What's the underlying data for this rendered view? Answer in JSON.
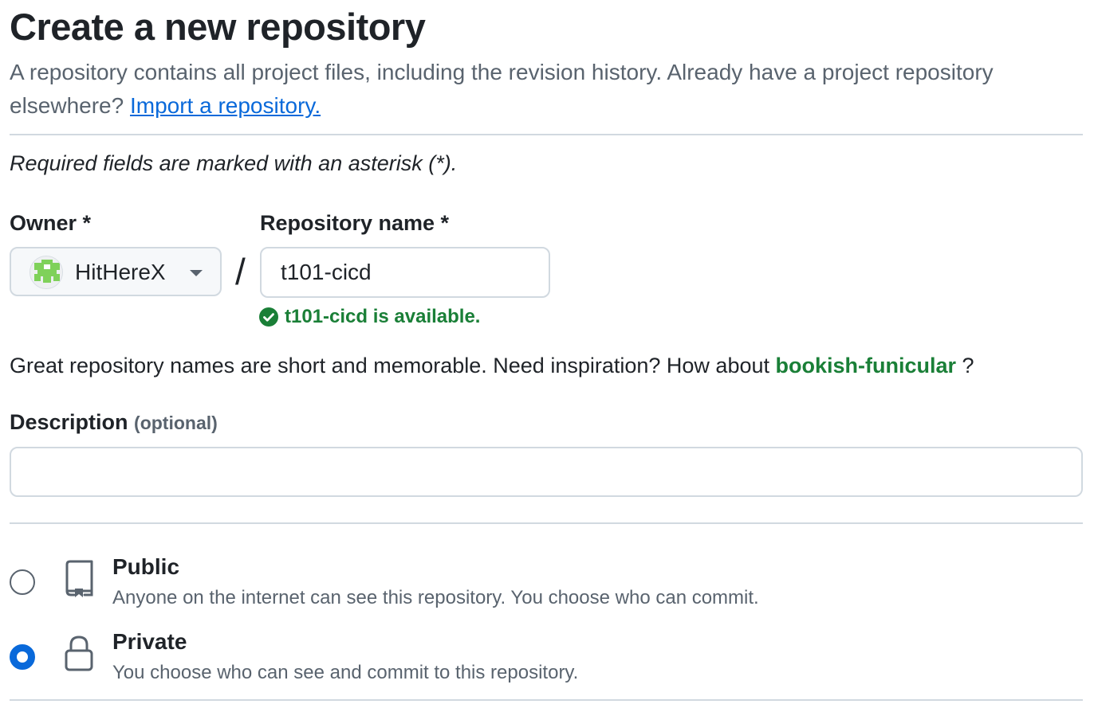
{
  "header": {
    "title": "Create a new repository",
    "subtitle": "A repository contains all project files, including the revision history. Already have a project repository elsewhere?",
    "import_link": "Import a repository."
  },
  "form": {
    "required_note": "Required fields are marked with an asterisk (*).",
    "owner": {
      "label": "Owner *",
      "value": "HitHereX"
    },
    "separator": "/",
    "repo_name": {
      "label": "Repository name *",
      "value": "t101-cicd",
      "availability": "t101-cicd is available."
    },
    "inspiration": {
      "text": "Great repository names are short and memorable. Need inspiration? How about",
      "suggestion": "bookish-funicular",
      "suffix": "?"
    },
    "description": {
      "label": "Description",
      "optional": "(optional)",
      "value": ""
    },
    "visibility": [
      {
        "title": "Public",
        "description": "Anyone on the internet can see this repository. You choose who can commit.",
        "icon": "repo-icon",
        "selected": false
      },
      {
        "title": "Private",
        "description": "You choose who can see and commit to this repository.",
        "icon": "lock-icon",
        "selected": true
      }
    ]
  },
  "colors": {
    "link": "#0969da",
    "success": "#1a7f37",
    "muted": "#59636e",
    "border": "#d1d9e0",
    "avatar_green": "#7fd15a"
  }
}
